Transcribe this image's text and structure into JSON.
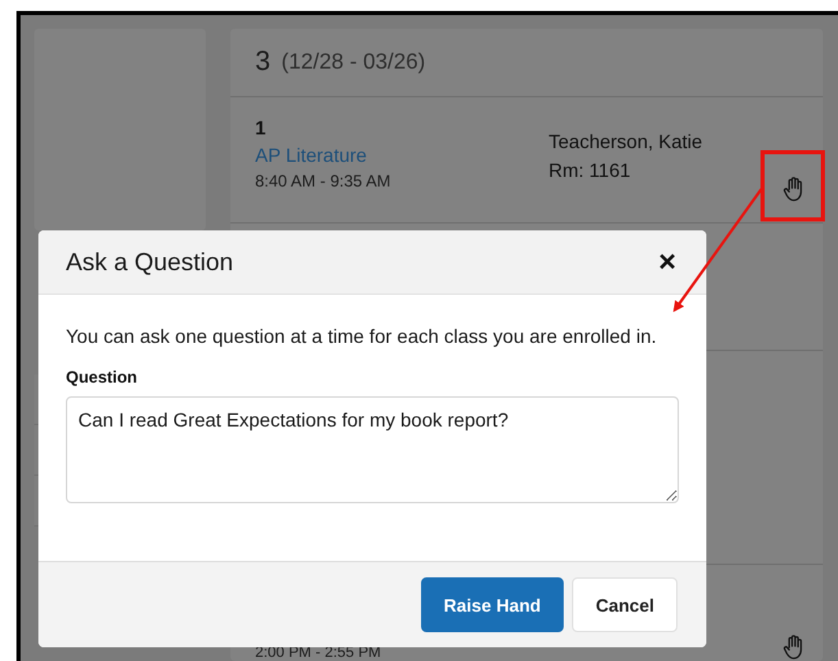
{
  "background": {
    "term": {
      "number": "3",
      "dates": "(12/28 - 03/26)"
    },
    "periods": [
      {
        "period": "1",
        "course": "AP Literature",
        "time": "8:40 AM - 9:35 AM",
        "teacher": "Teacherson, Katie",
        "room": "Rm: 1161"
      }
    ],
    "last_row": {
      "time": "2:00 PM - 2:55 PM"
    }
  },
  "dialog": {
    "title": "Ask a Question",
    "close": "×",
    "message": "You can ask one question at a time for each class you are enrolled in.",
    "field_label": "Question",
    "value": "Can I read Great Expectations for my book report?",
    "buttons": [
      {
        "label": "Raise Hand",
        "kind": "primary"
      },
      {
        "label": "Cancel",
        "kind": "secondary"
      }
    ]
  }
}
